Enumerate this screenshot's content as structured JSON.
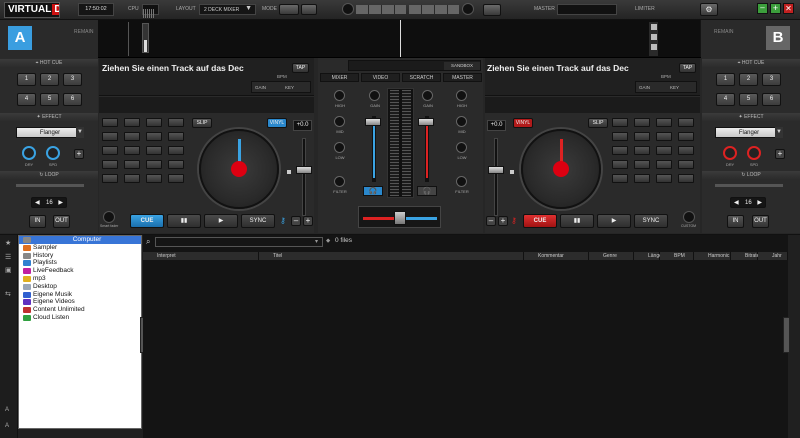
{
  "app": {
    "logo_a": "VIRTUAL",
    "logo_b": "DJ"
  },
  "topbar": {
    "time": "17:50:02",
    "cpu_label": "CPU",
    "layout_label": "LAYOUT",
    "layout_value": "2 DECK MIXER",
    "mode_label": "MODE",
    "master_label": "MASTER",
    "limiter_label": "LIMITER"
  },
  "decks": {
    "left": {
      "letter": "A",
      "remain": "REMAIN",
      "title": "Ziehen Sie einen Track auf das Dec",
      "tap": "TAP",
      "bpm": "BPM",
      "gain": "GAIN",
      "key": "KEY",
      "slip": "SLIP",
      "vinyl": "VINYL",
      "pitch": "+0.0",
      "cue": "CUE",
      "play_pause": "▮▮",
      "play": "▶",
      "sync": "SYNC",
      "smart_fader": "Smart fader",
      "accent": "#3aa3e3"
    },
    "right": {
      "letter": "B",
      "remain": "REMAIN",
      "title": "Ziehen Sie einen Track auf das Dec",
      "tap": "TAP",
      "bpm": "BPM",
      "gain": "GAIN",
      "key": "KEY",
      "slip": "SLIP",
      "vinyl": "VINYL",
      "pitch": "+0.0",
      "cue": "CUE",
      "play_pause": "▮▮",
      "play": "▶",
      "sync": "SYNC",
      "custom": "CUSTOM",
      "accent": "#dd2222"
    }
  },
  "side": {
    "hotcue": "HOT CUE",
    "effect": "EFFECT",
    "loop": "LOOP",
    "hotcue_buttons": [
      "1",
      "2",
      "3",
      "4",
      "5",
      "6"
    ],
    "effect_name": "Flanger",
    "dry_label": "DRY",
    "spd_label": "SPD",
    "loop_value": "16",
    "in_label": "IN",
    "out_label": "OUT"
  },
  "mixer": {
    "sandbox": "SANDBOX",
    "tabs": [
      "MIXER",
      "VIDEO",
      "SCRATCH",
      "MASTER"
    ],
    "gain": "GAIN",
    "high": "HIGH",
    "mid": "MID",
    "low": "LOW",
    "filter": "FILTER"
  },
  "browser": {
    "search_placeholder": "",
    "file_count": "0 files",
    "tree": [
      {
        "label": "Computer",
        "icon": "computer-icon",
        "color": "#888888",
        "selected": true
      },
      {
        "label": "Sampler",
        "icon": "sampler-icon",
        "color": "#e07020"
      },
      {
        "label": "History",
        "icon": "history-icon",
        "color": "#888888"
      },
      {
        "label": "Playlists",
        "icon": "playlists-icon",
        "color": "#3080d0"
      },
      {
        "label": "LiveFeedback",
        "icon": "livefeedback-icon",
        "color": "#c020a0"
      },
      {
        "label": "mp3",
        "icon": "folder-icon",
        "color": "#e0b020"
      },
      {
        "label": "Desktop",
        "icon": "desktop-icon",
        "color": "#9aa6b8"
      },
      {
        "label": "Eigene Musik",
        "icon": "music-folder-icon",
        "color": "#3060d0"
      },
      {
        "label": "Eigene Videos",
        "icon": "video-folder-icon",
        "color": "#6030c0"
      },
      {
        "label": "Content Unlimited",
        "icon": "content-unlimited-icon",
        "color": "#c03030"
      },
      {
        "label": "Cloud Listen",
        "icon": "cloud-icon",
        "color": "#30a040"
      }
    ],
    "columns": [
      "Interpret",
      "Titel",
      "Kommentar",
      "Genre",
      "Länge",
      "BPM",
      "Harmonic",
      "Bitrate",
      "Jahr"
    ]
  }
}
